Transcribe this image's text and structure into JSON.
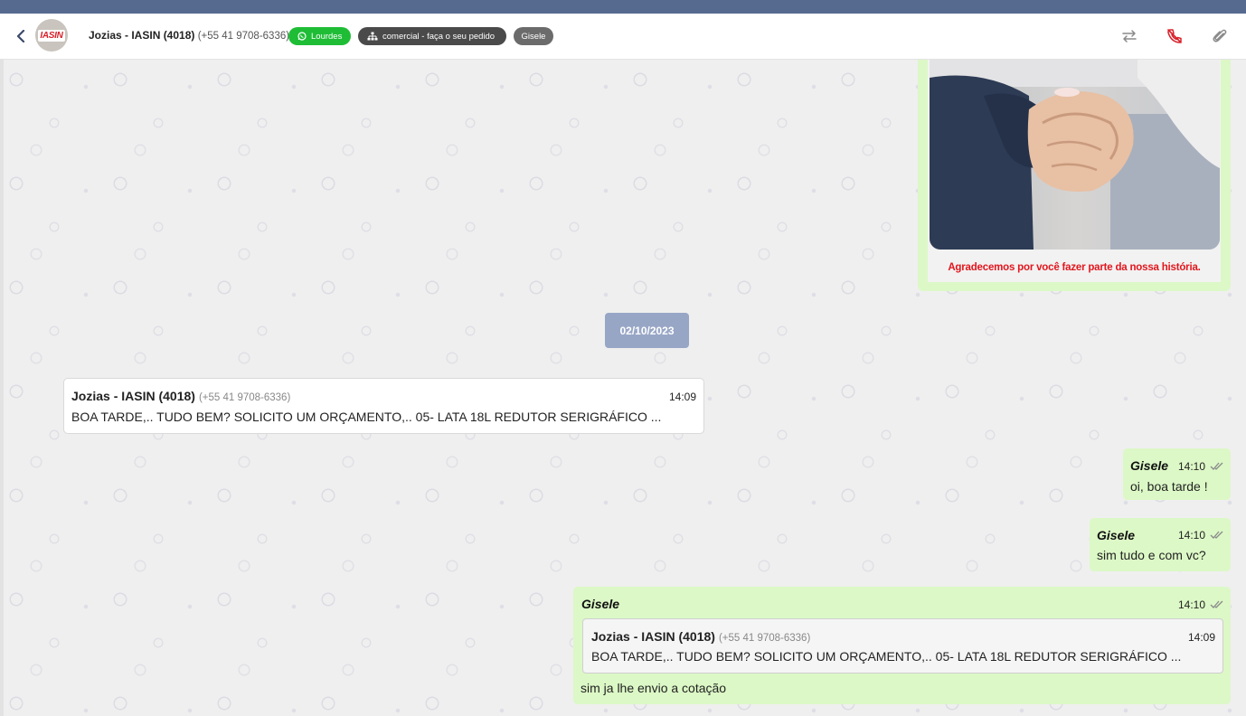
{
  "header": {
    "contact_name": "Jozias - IASIN (4018)",
    "contact_phone": "(+55 41 9708-6336)",
    "avatar_logo": "IASIN",
    "connection_badge": "Lourdes",
    "queue_badge": "comercial - faça o seu pedido",
    "user_badge": "Gisele"
  },
  "colors": {
    "topbar": "#56698f",
    "whatsapp_green": "#1fbd36",
    "outgoing_bubble": "#dcf8c6",
    "date_chip": "#98a6c6",
    "caption_red": "#e2161d"
  },
  "icons": {
    "back": "chevron-left-icon",
    "transfer": "transfer-arrows-icon",
    "hangup": "phone-off-icon",
    "attach": "paperclip-icon"
  },
  "image_message": {
    "caption": "Agradecemos por você fazer parte da nossa história."
  },
  "date_separator": "02/10/2023",
  "messages": [
    {
      "direction": "in",
      "sender": "Jozias - IASIN (4018)",
      "phone": "(+55 41 9708-6336)",
      "time": "14:09",
      "text": "BOA TARDE,.. TUDO BEM? SOLICITO UM ORÇAMENTO,.. 05- LATA 18L REDUTOR SERIGRÁFICO ..."
    },
    {
      "direction": "out",
      "sender": "Gisele",
      "time": "14:10",
      "text": "oi, boa tarde !"
    },
    {
      "direction": "out",
      "sender": "Gisele",
      "time": "14:10",
      "text": "sim tudo e com vc?"
    },
    {
      "direction": "out",
      "sender": "Gisele",
      "time": "14:10",
      "quote": {
        "sender": "Jozias - IASIN (4018)",
        "phone": "(+55 41 9708-6336)",
        "time": "14:09",
        "text": "BOA TARDE,.. TUDO BEM? SOLICITO UM ORÇAMENTO,.. 05- LATA 18L REDUTOR SERIGRÁFICO ..."
      },
      "text": "sim ja lhe envio a cotação"
    }
  ]
}
